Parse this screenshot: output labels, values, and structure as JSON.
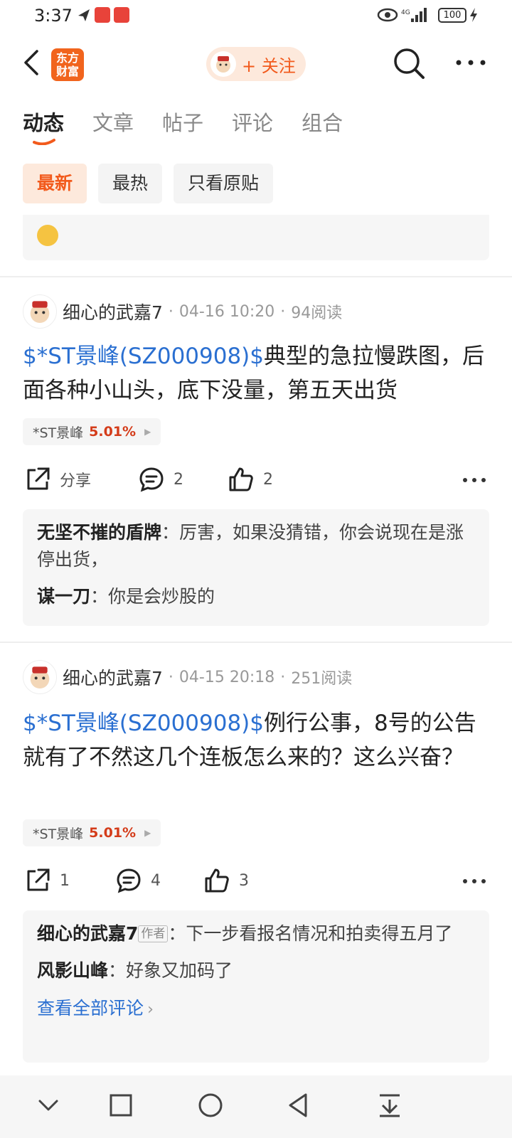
{
  "status_bar": {
    "time": "3:37",
    "battery": "100"
  },
  "header": {
    "logo_line1": "东方",
    "logo_line2": "财富",
    "follow_label": "+ 关注"
  },
  "tabs": [
    {
      "label": "动态",
      "active": true
    },
    {
      "label": "文章"
    },
    {
      "label": "帖子"
    },
    {
      "label": "评论"
    },
    {
      "label": "组合"
    }
  ],
  "filters": [
    {
      "label": "最新",
      "active": true
    },
    {
      "label": "最热"
    },
    {
      "label": "只看原贴"
    }
  ],
  "posts": [
    {
      "author": "细心的武嘉7",
      "time": "04-16 10:20",
      "reads": "94阅读",
      "stock_link": "$*ST景峰(SZ000908)$",
      "text": "典型的急拉慢跌图，后面各种小山头，底下没量，第五天出货",
      "tag_name": "*ST景峰",
      "tag_change": "5.01%",
      "share_label": "分享",
      "comment_count": "2",
      "like_count": "2",
      "comments": [
        {
          "user": "无坚不摧的盾牌",
          "sep": "：",
          "text": "厉害，如果没猜错，你会说现在是涨停出货，"
        },
        {
          "user": "谋一刀",
          "sep": "：",
          "text": "你是会炒股的"
        }
      ]
    },
    {
      "author": "细心的武嘉7",
      "time": "04-15 20:18",
      "reads": "251阅读",
      "stock_link": "$*ST景峰(SZ000908)$",
      "text": "例行公事，8号的公告就有了不然这几个连板怎么来的？这么兴奋？",
      "tag_name": "*ST景峰",
      "tag_change": "5.01%",
      "share_count": "1",
      "comment_count": "4",
      "like_count": "3",
      "comments": [
        {
          "user": "细心的武嘉7",
          "badge": "作者",
          "sep": "：",
          "text": "下一步看报名情况和拍卖得五月了"
        },
        {
          "user": "风影山峰",
          "sep": "：",
          "text": "好象又加码了"
        }
      ],
      "view_all": "查看全部评论"
    }
  ],
  "colors": {
    "accent": "#f25a1c",
    "link": "#2a6fd1",
    "rise": "#d43c1a"
  }
}
